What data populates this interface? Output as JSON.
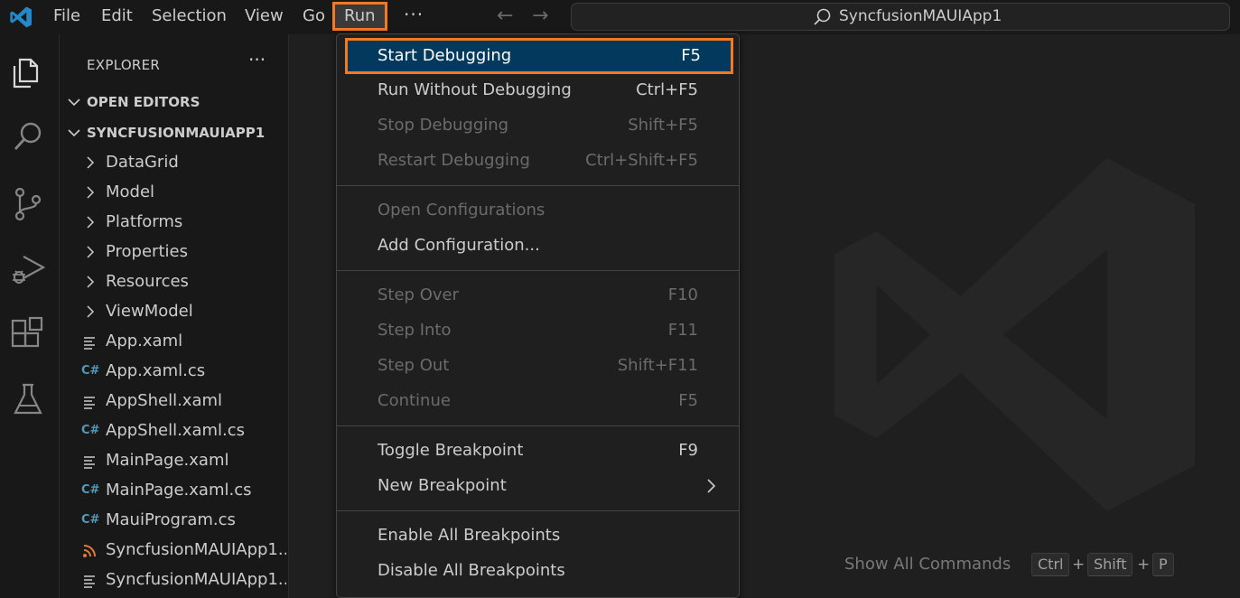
{
  "menubar": {
    "items": [
      "File",
      "Edit",
      "Selection",
      "View",
      "Go",
      "Run"
    ],
    "more": "···"
  },
  "command_center": {
    "text": "SyncfusionMAUIApp1"
  },
  "activity_bar": {
    "icons": [
      "explorer-icon",
      "search-icon",
      "source-control-icon",
      "run-debug-icon",
      "extensions-icon",
      "testing-icon"
    ]
  },
  "sidebar": {
    "title": "EXPLORER",
    "more": "···",
    "open_editors": "OPEN EDITORS",
    "project": "SYNCFUSIONMAUIAPP1",
    "folders": [
      "DataGrid",
      "Model",
      "Platforms",
      "Properties",
      "Resources",
      "ViewModel"
    ],
    "files": [
      {
        "name": "App.xaml",
        "icon": "xaml-icon"
      },
      {
        "name": "App.xaml.cs",
        "icon": "csharp-icon"
      },
      {
        "name": "AppShell.xaml",
        "icon": "xaml-icon"
      },
      {
        "name": "AppShell.xaml.cs",
        "icon": "csharp-icon"
      },
      {
        "name": "MainPage.xaml",
        "icon": "xaml-icon"
      },
      {
        "name": "MainPage.xaml.cs",
        "icon": "csharp-icon"
      },
      {
        "name": "MauiProgram.cs",
        "icon": "csharp-icon"
      },
      {
        "name": "SyncfusionMAUIApp1...",
        "icon": "rss-icon"
      },
      {
        "name": "SyncfusionMAUIApp1...",
        "icon": "xaml-icon"
      }
    ]
  },
  "run_menu": {
    "items": [
      {
        "label": "Start Debugging",
        "key": "F5",
        "enabled": true,
        "highlighted": true
      },
      {
        "label": "Run Without Debugging",
        "key": "Ctrl+F5",
        "enabled": true
      },
      {
        "label": "Stop Debugging",
        "key": "Shift+F5",
        "enabled": false
      },
      {
        "label": "Restart Debugging",
        "key": "Ctrl+Shift+F5",
        "enabled": false
      },
      {
        "label": "Open Configurations",
        "key": "",
        "enabled": false
      },
      {
        "label": "Add Configuration...",
        "key": "",
        "enabled": true
      },
      {
        "label": "Step Over",
        "key": "F10",
        "enabled": false
      },
      {
        "label": "Step Into",
        "key": "F11",
        "enabled": false
      },
      {
        "label": "Step Out",
        "key": "Shift+F11",
        "enabled": false
      },
      {
        "label": "Continue",
        "key": "F5",
        "enabled": false
      },
      {
        "label": "Toggle Breakpoint",
        "key": "F9",
        "enabled": true
      },
      {
        "label": "New Breakpoint",
        "key": "",
        "enabled": true,
        "submenu": true
      },
      {
        "label": "Enable All Breakpoints",
        "key": "",
        "enabled": true
      },
      {
        "label": "Disable All Breakpoints",
        "key": "",
        "enabled": true
      }
    ]
  },
  "editor": {
    "hint_label": "Show All Commands",
    "keys": [
      "Ctrl",
      "Shift",
      "P"
    ],
    "plus": "+"
  },
  "colors": {
    "accent_highlight": "#f47920",
    "selection_bg": "#04395e",
    "vscode_blue": "#2489ca"
  }
}
